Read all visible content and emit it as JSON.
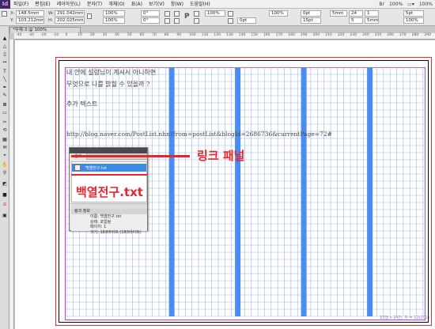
{
  "app": {
    "logo": "Id"
  },
  "menubar": {
    "items": [
      "파일(F)",
      "편집(E)",
      "레이아웃(L)",
      "문자(T)",
      "개체(O)",
      "표(A)",
      "보기(V)",
      "창(W)",
      "도움말(H)"
    ],
    "zoom_left": "100%",
    "zoom_right": "100%"
  },
  "control": {
    "x_label": "X:",
    "x_value": "148.5mm",
    "y_label": "Y:",
    "y_value": "103.212mm",
    "w_label": "W:",
    "w_value": "291.042mm",
    "h_label": "H:",
    "h_value": "202.025mm",
    "scale_x": "100%",
    "scale_y": "100%",
    "rotate": "0°",
    "shear": "0°",
    "zoom": "100%",
    "stroke": "0pt",
    "pct2": "100%",
    "pt": "0pt",
    "dim1": "5mm",
    "col": "1",
    "num_24": "24",
    "num_5": "5",
    "size_15": "15pt",
    "right_pt": "5pt",
    "right_5mm": "5mm",
    "right_pct": "100%"
  },
  "document": {
    "tab_label": "*무제-3 @ 100%"
  },
  "ruler": {
    "marks": [
      "-40",
      "-30",
      "-20",
      "-10",
      "0",
      "10",
      "20",
      "30",
      "40",
      "50",
      "60",
      "70",
      "80",
      "90",
      "100",
      "110",
      "120",
      "130",
      "140",
      "150",
      "160",
      "170",
      "180",
      "190",
      "200",
      "210",
      "220",
      "230",
      "240",
      "250",
      "260",
      "270",
      "280",
      "290"
    ]
  },
  "page_text": {
    "line1": "내 안에 설렁님이 계셔서 아니하면",
    "line2": "무엇으로 나를 밝힐 수 있을까 ?",
    "line3": "추가 텍스트",
    "url": "http://blog.naver.com/PostList.nhn?from=postList&blogId=2686736&currentPage=72#"
  },
  "link_panel": {
    "tab": "링크",
    "item": "백열전구.txt",
    "info_title": "링크 정보",
    "info_lines": [
      "이름: 백열전구.txt",
      "상태: 포함됨",
      "페이지: 1",
      "크기: 183바이트 (183바이트)"
    ]
  },
  "annotations": {
    "panel": "링크 패널",
    "file": "백열전구.txt"
  },
  "status_note": "33행 x 24칸, 자 = 12(201)"
}
